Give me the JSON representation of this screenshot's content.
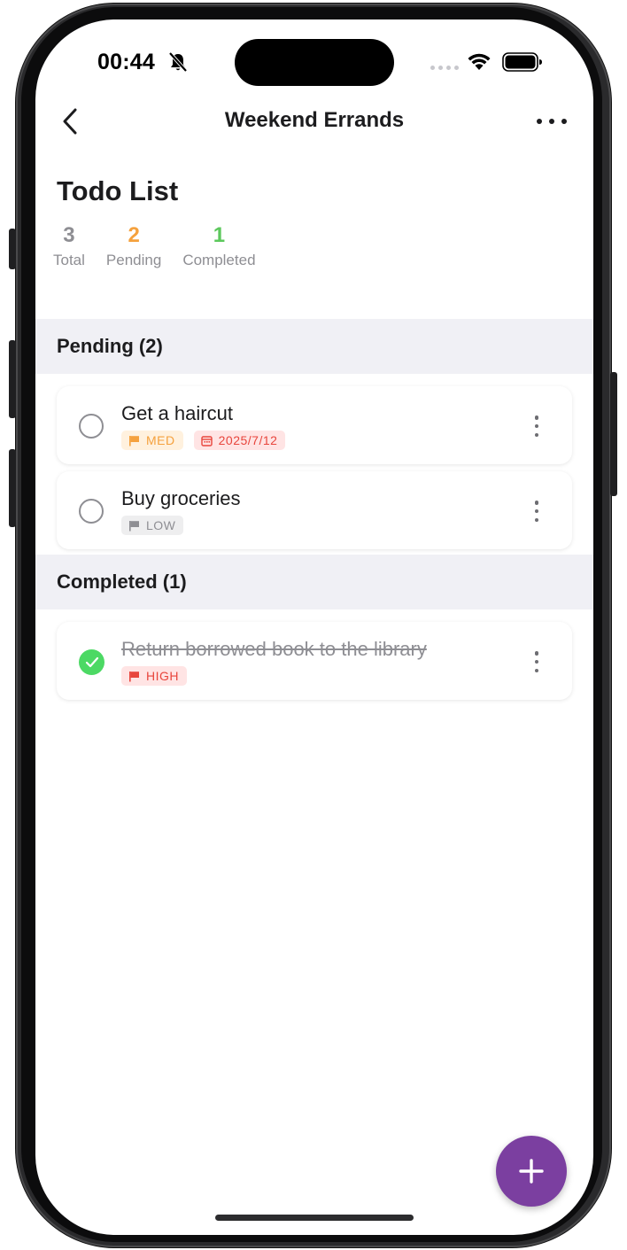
{
  "status_bar": {
    "time": "00:44",
    "icons": [
      "bell-slash-icon",
      "signal-dots-icon",
      "wifi-icon",
      "battery-icon"
    ]
  },
  "nav": {
    "title": "Weekend Errands",
    "back_icon": "chevron-left-icon",
    "more_icon": "ellipsis-icon"
  },
  "header": {
    "title": "Todo List",
    "stats": [
      {
        "value": "3",
        "label": "Total",
        "color": "#8e8e93"
      },
      {
        "value": "2",
        "label": "Pending",
        "color": "#f5a13d"
      },
      {
        "value": "1",
        "label": "Completed",
        "color": "#5cc85c"
      }
    ]
  },
  "sections": {
    "pending": {
      "label": "Pending (2)",
      "items": [
        {
          "title": "Get a haircut",
          "priority": "MED",
          "due": "2025/7/12",
          "completed": false
        },
        {
          "title": "Buy groceries",
          "priority": "LOW",
          "completed": false
        }
      ]
    },
    "completed": {
      "label": "Completed (1)",
      "items": [
        {
          "title": "Return borrowed book to the library",
          "priority": "HIGH",
          "completed": true
        }
      ]
    }
  },
  "fab": {
    "icon": "plus-icon"
  },
  "colors": {
    "accent": "#7b3fa0",
    "pending": "#f5a13d",
    "completed": "#5cc85c",
    "high": "#e8453c",
    "low": "#8e8e93"
  }
}
